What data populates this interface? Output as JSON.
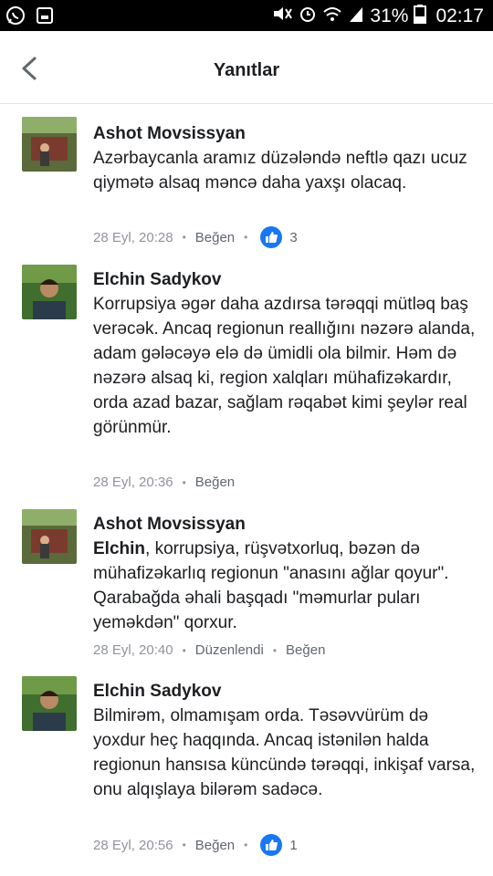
{
  "status_bar": {
    "battery_percent": "31%",
    "time": "02:17",
    "icons": [
      "whatsapp-icon",
      "gallery-icon",
      "mute-icon",
      "alarm-icon",
      "wifi-icon",
      "signal-icon",
      "battery-icon"
    ]
  },
  "header": {
    "title": "Yanıtlar",
    "back_icon": "chevron-left-icon"
  },
  "comments": [
    {
      "author": "Ashot Movsissyan",
      "text": "Azərbaycanla aramız düzələndə neftlə qazı ucuz qiymətə alsaq məncə daha yaxşı olacaq.",
      "timestamp": "28 Eyl, 20:28",
      "like_label": "Beğen",
      "like_count": "3"
    },
    {
      "author": "Elchin Sadykov",
      "text": "Korrupsiya əgər daha azdırsa tərəqqi mütləq baş verəcək. Ancaq regionun reallığını nəzərə alanda, adam gələcəyə elə də ümidli ola bilmir. Həm də nəzərə alsaq ki, region xalqları mühafizəkardır, orda azad bazar, sağlam rəqabət kimi şeylər real görünmür.",
      "timestamp": "28 Eyl, 20:36",
      "like_label": "Beğen"
    },
    {
      "author": "Ashot Movsissyan",
      "mention": "Elchin",
      "text": ", korrupsiya, rüşvətxorluq, bəzən də mühafizəkarlıq regionun \"anasını ağlar qoyur\". Qarabağda əhali başqadı \"məmurlar puları yeməkdən\" qorxur.",
      "timestamp": "28 Eyl, 20:40",
      "edited_label": "Düzenlendi",
      "like_label": "Beğen"
    },
    {
      "author": "Elchin Sadykov",
      "text": "Bilmirəm, olmamışam orda. Təsəvvürüm də yoxdur heç haqqında. Ancaq istənilən halda regionun hansısa küncündə tərəqqi, inkişaf varsa, onu alqışlaya bilərəm sadəcə.",
      "timestamp": "28 Eyl, 20:56",
      "like_label": "Beğen",
      "like_count": "1"
    }
  ]
}
